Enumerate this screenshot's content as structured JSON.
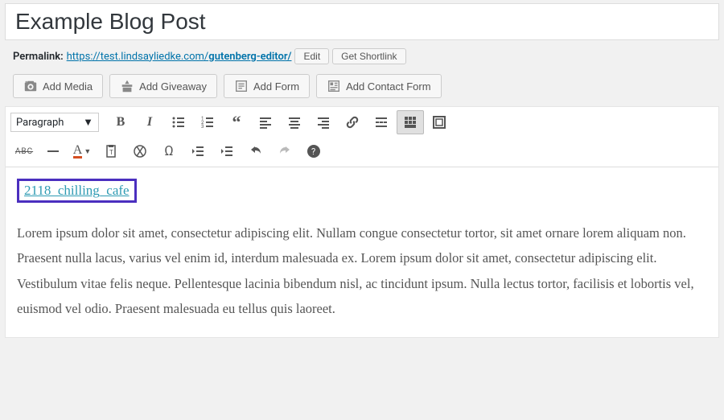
{
  "title": "Example Blog Post",
  "permalink": {
    "label": "Permalink:",
    "base": "https://test.lindsayliedke.com/",
    "slug": "gutenberg-editor/",
    "edit": "Edit",
    "shortlink": "Get Shortlink"
  },
  "media_buttons": {
    "add_media": "Add Media",
    "add_giveaway": "Add Giveaway",
    "add_form": "Add Form",
    "add_contact_form": "Add Contact Form"
  },
  "toolbar": {
    "format": "Paragraph"
  },
  "content": {
    "shortcode_text": "2118_chilling_cafe",
    "body": "Lorem ipsum dolor sit amet, consectetur adipiscing elit. Nullam congue consectetur tortor, sit amet ornare lorem aliquam non. Praesent nulla lacus, varius vel enim id, interdum malesuada ex. Lorem ipsum dolor sit amet, consectetur adipiscing elit. Vestibulum vitae felis neque. Pellentesque lacinia bibendum nisl, ac tincidunt ipsum. Nulla lectus tortor, facilisis et lobortis vel, euismod vel odio. Praesent malesuada eu tellus quis laoreet."
  }
}
